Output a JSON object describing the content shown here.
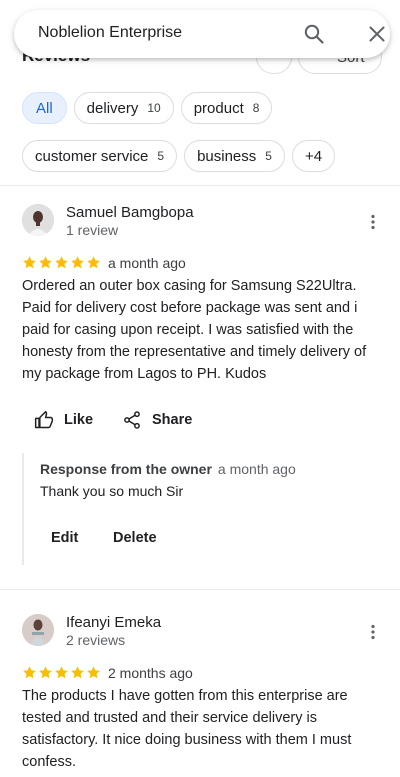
{
  "search": {
    "query": "Noblelion Enterprise",
    "search_icon": "search-icon",
    "close_icon": "close-icon"
  },
  "header": {
    "title": "Reviews",
    "sort_label": "Sort"
  },
  "filters": {
    "row1": [
      {
        "label": "All",
        "count": "",
        "selected": true
      },
      {
        "label": "delivery",
        "count": "10",
        "selected": false
      },
      {
        "label": "product",
        "count": "8",
        "selected": false
      }
    ],
    "row2": [
      {
        "label": "customer service",
        "count": "5",
        "selected": false
      },
      {
        "label": "business",
        "count": "5",
        "selected": false
      },
      {
        "label": "+4",
        "count": "",
        "selected": false
      }
    ]
  },
  "reviews": [
    {
      "name": "Samuel Bamgbopa",
      "meta": "1 review",
      "rating": 5,
      "time": "a month ago",
      "text": "Ordered an outer box casing for Samsung S22Ultra. Paid for delivery cost before package was sent and i paid for casing upon receipt. I was satisfied with the honesty from the representative and timely delivery of my package from Lagos to PH. Kudos",
      "like_label": "Like",
      "share_label": "Share",
      "response": {
        "title": "Response from the owner",
        "time": "a month ago",
        "text": "Thank you so much Sir",
        "edit_label": "Edit",
        "delete_label": "Delete"
      }
    },
    {
      "name": "Ifeanyi Emeka",
      "meta": "2 reviews",
      "rating": 5,
      "time": "2 months ago",
      "text": "The products I have gotten from this enterprise are tested and trusted and their service delivery is satisfactory. It nice doing business with them I must confess."
    }
  ],
  "colors": {
    "star": "#fbbc04",
    "chip_selected_bg": "#e8f0fe",
    "chip_selected_text": "#1967d2"
  }
}
